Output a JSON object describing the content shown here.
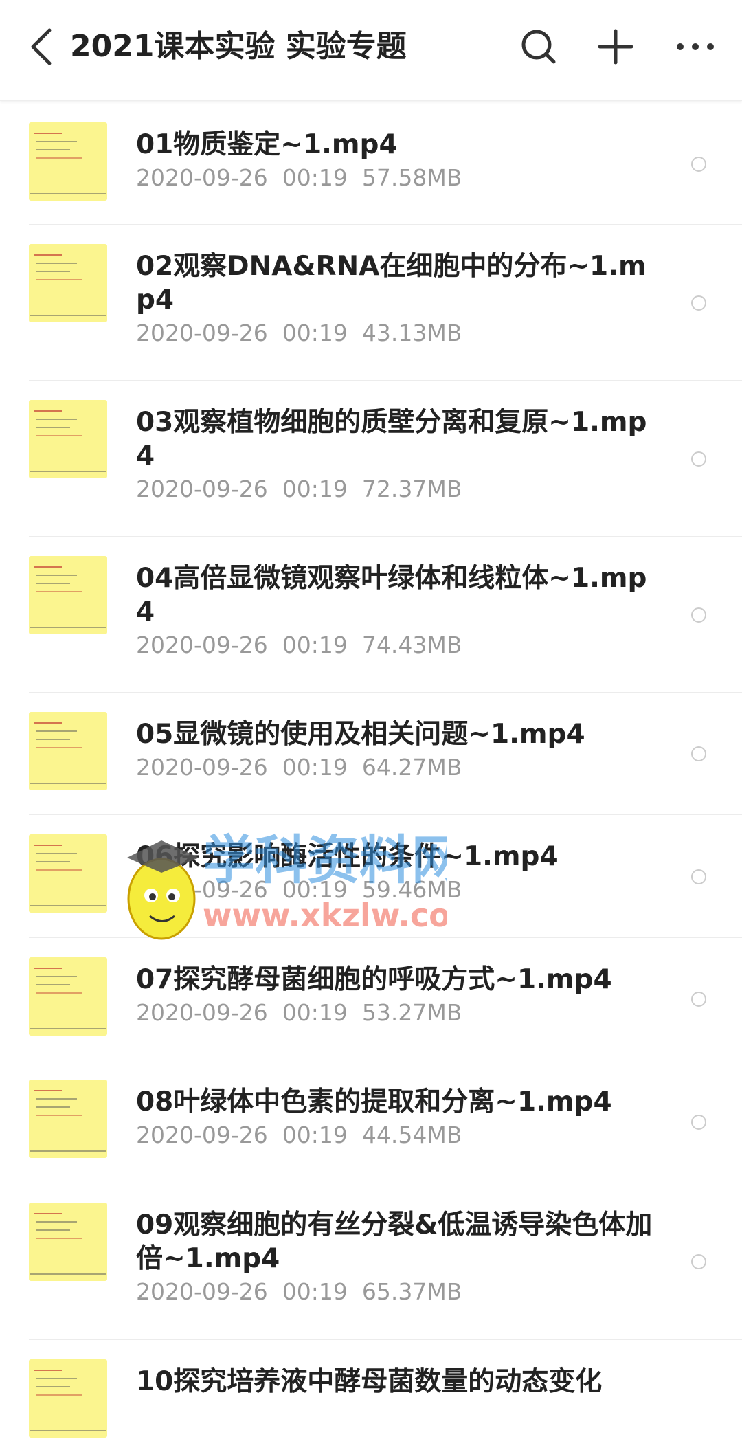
{
  "header": {
    "title": "2021课本实验 实验专题",
    "back_icon": "chevron-left-icon",
    "search_icon": "search-icon",
    "add_icon": "plus-icon",
    "more_icon": "more-horizontal-icon"
  },
  "files": [
    {
      "name": "01物质鉴定~1.mp4",
      "date": "2020-09-26",
      "time": "00:19",
      "size": "57.58MB"
    },
    {
      "name": "02观察DNA&RNA在细胞中的分布~1.mp4",
      "date": "2020-09-26",
      "time": "00:19",
      "size": "43.13MB"
    },
    {
      "name": "03观察植物细胞的质壁分离和复原~1.mp4",
      "date": "2020-09-26",
      "time": "00:19",
      "size": "72.37MB"
    },
    {
      "name": "04高倍显微镜观察叶绿体和线粒体~1.mp4",
      "date": "2020-09-26",
      "time": "00:19",
      "size": "74.43MB"
    },
    {
      "name": "05显微镜的使用及相关问题~1.mp4",
      "date": "2020-09-26",
      "time": "00:19",
      "size": "64.27MB"
    },
    {
      "name": "06探究影响酶活性的条件~1.mp4",
      "date": "2020-09-26",
      "time": "00:19",
      "size": "59.46MB"
    },
    {
      "name": "07探究酵母菌细胞的呼吸方式~1.mp4",
      "date": "2020-09-26",
      "time": "00:19",
      "size": "53.27MB"
    },
    {
      "name": "08叶绿体中色素的提取和分离~1.mp4",
      "date": "2020-09-26",
      "time": "00:19",
      "size": "44.54MB"
    },
    {
      "name": "09观察细胞的有丝分裂&低温诱导染色体加倍~1.mp4",
      "date": "2020-09-26",
      "time": "00:19",
      "size": "65.37MB"
    },
    {
      "name": "10探究培养液中酵母菌数量的动态变化",
      "date": "",
      "time": "",
      "size": ""
    }
  ],
  "watermark": {
    "line1": "学科资料网",
    "line2": "www.xkzlw.com"
  },
  "colors": {
    "thumb_bg": "#fbf58f",
    "meta_text": "#999999",
    "title_text": "#222222",
    "watermark_blue": "#2f8fe0",
    "watermark_red": "#f36b5a"
  }
}
